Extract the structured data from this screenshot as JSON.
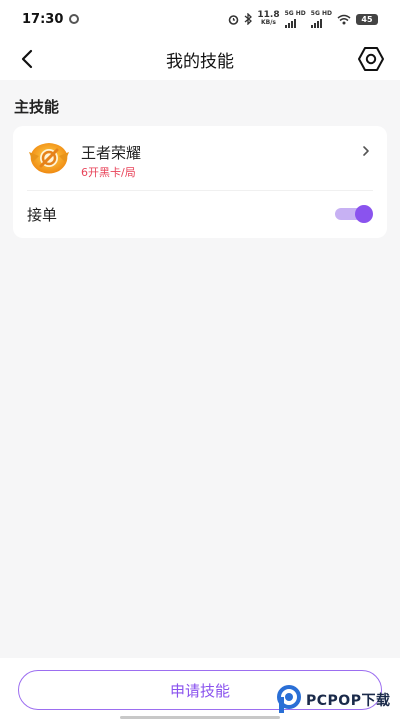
{
  "status_bar": {
    "time": "17:30",
    "net_speed_top": "11.8",
    "net_speed_bottom": "KB/s",
    "sim1": "5G HD",
    "sim2": "5G HD",
    "battery": "45"
  },
  "header": {
    "title": "我的技能",
    "back_icon": "chevron-left-icon",
    "settings_icon": "hexagon-settings-icon"
  },
  "section": {
    "title": "主技能"
  },
  "skill": {
    "name": "王者荣耀",
    "price": "6开黑卡/局",
    "accent_color": "#e8445a"
  },
  "accept": {
    "label": "接单",
    "enabled": true,
    "toggle_color": "#8a53ee"
  },
  "footer": {
    "apply_label": "申请技能"
  },
  "watermark": {
    "text": "PCPOP下载"
  }
}
